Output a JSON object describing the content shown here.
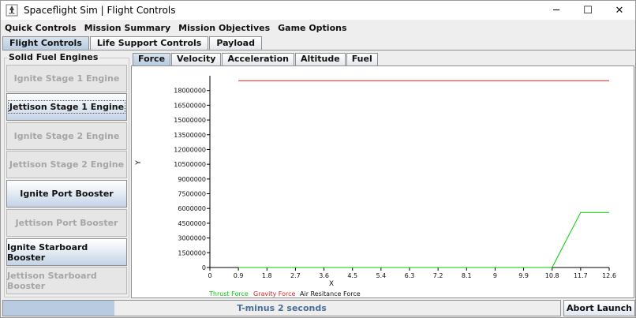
{
  "window": {
    "title": "Spaceflight Sim | Flight Controls",
    "icon": "rocket-app-icon",
    "controls": {
      "minimize": "─",
      "maximize": "☐",
      "close": "✕"
    }
  },
  "menu": [
    "Quick Controls",
    "Mission Summary",
    "Mission Objectives",
    "Game Options"
  ],
  "tabs": [
    {
      "label": "Flight Controls",
      "active": true
    },
    {
      "label": "Life Support Controls",
      "active": false
    },
    {
      "label": "Payload",
      "active": false
    }
  ],
  "engines_panel": {
    "title": "Solid Fuel Engines",
    "buttons": [
      {
        "label": "Ignite Stage 1 Engine",
        "enabled": false
      },
      {
        "label": "Jettison Stage 1 Engine",
        "enabled": true,
        "focused": true
      },
      {
        "label": "Ignite Stage 2 Engine",
        "enabled": false
      },
      {
        "label": "Jettison Stage 2 Engine",
        "enabled": false
      },
      {
        "label": "Ignite Port Booster",
        "enabled": true
      },
      {
        "label": "Jettison Port Booster",
        "enabled": false
      },
      {
        "label": "Ignite Starboard Booster",
        "enabled": true
      },
      {
        "label": "Jettison Starboard Booster",
        "enabled": false
      }
    ]
  },
  "chart_tabs": [
    {
      "label": "Force",
      "active": true
    },
    {
      "label": "Velocity",
      "active": false
    },
    {
      "label": "Acceleration",
      "active": false
    },
    {
      "label": "Altitude",
      "active": false
    },
    {
      "label": "Fuel",
      "active": false
    }
  ],
  "chart_data": {
    "type": "line",
    "title": "",
    "xlabel": "X",
    "ylabel": "Y",
    "xlim": [
      0,
      12.6
    ],
    "ylim": [
      0,
      19500000
    ],
    "x_ticks": [
      "0",
      "0.9",
      "1.8",
      "2.7",
      "3.6",
      "4.5",
      "5.4",
      "6.3",
      "7.2",
      "8.1",
      "9",
      "9.9",
      "10.8",
      "11.7",
      "12.6"
    ],
    "x_tick_values": [
      0,
      0.9,
      1.8,
      2.7,
      3.6,
      4.5,
      5.4,
      6.3,
      7.2,
      8.1,
      9,
      9.9,
      10.8,
      11.7,
      12.6
    ],
    "y_ticks": [
      "0",
      "1500000",
      "3000000",
      "4500000",
      "6000000",
      "7500000",
      "9000000",
      "10500000",
      "12000000",
      "13500000",
      "15000000",
      "16500000",
      "18000000"
    ],
    "y_tick_values": [
      0,
      1500000,
      3000000,
      4500000,
      6000000,
      7500000,
      9000000,
      10500000,
      12000000,
      13500000,
      15000000,
      16500000,
      18000000
    ],
    "grid": false,
    "legend_position": "bottom-left",
    "series": [
      {
        "name": "Thrust Force",
        "color": "#00cc00",
        "points": [
          [
            0.9,
            0
          ],
          [
            10.8,
            0
          ],
          [
            11.7,
            5600000
          ],
          [
            12.6,
            5600000
          ]
        ]
      },
      {
        "name": "Gravity Force",
        "color": "#e01e1e",
        "points": [
          [
            0.9,
            19000000
          ],
          [
            12.6,
            19000000
          ]
        ]
      },
      {
        "name": "Air Resitance Force",
        "color": "#111111",
        "points": []
      }
    ]
  },
  "status": {
    "progress_text": "T-minus 2 seconds",
    "progress": 0.2,
    "abort_label": "Abort Launch"
  },
  "colors": {
    "accent": "#b8cbe0",
    "progress_text": "#4a6f97",
    "disabled_text": "#a6a6a6"
  }
}
